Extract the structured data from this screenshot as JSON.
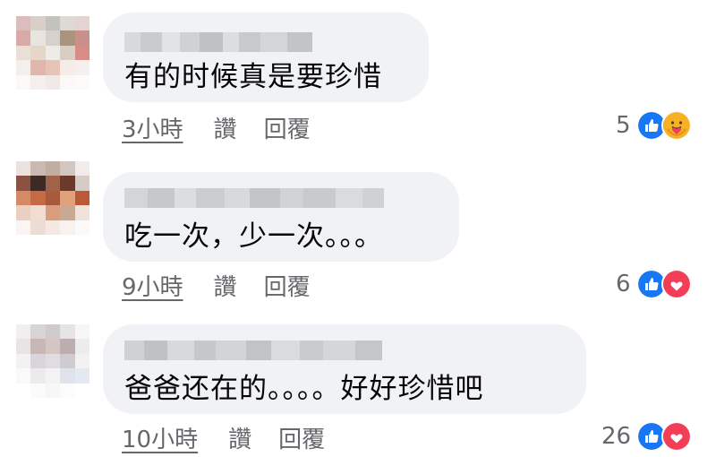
{
  "comments": [
    {
      "text": "有的时候真是要珍惜",
      "time": "3小時",
      "like_label": "讚",
      "reply_label": "回覆",
      "reaction_count": "5",
      "reactions": [
        "like",
        "care"
      ]
    },
    {
      "text": "吃一次，少一次。。。",
      "time": "9小時",
      "like_label": "讚",
      "reply_label": "回覆",
      "reaction_count": "6",
      "reactions": [
        "like",
        "love"
      ]
    },
    {
      "text": "爸爸还在的。。。。好好珍惜吧",
      "time": "10小時",
      "like_label": "讚",
      "reply_label": "回覆",
      "reaction_count": "26",
      "reactions": [
        "like",
        "love"
      ]
    }
  ],
  "colors": {
    "like_blue": "#1877f2",
    "love_red": "#f33e58",
    "care_yellow": "#f7b125",
    "bubble_bg": "#f0f2f5",
    "meta_gray": "#65676b"
  }
}
